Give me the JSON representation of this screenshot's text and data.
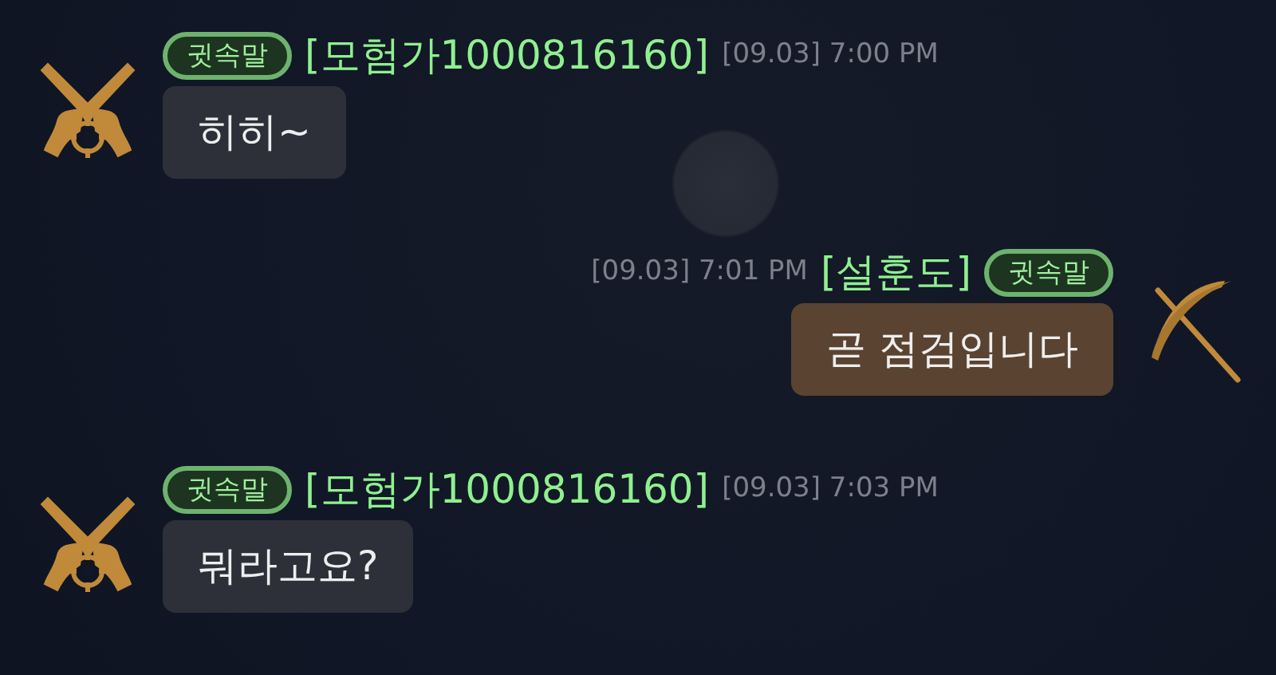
{
  "messages": [
    {
      "mine": false,
      "kind": "pistols",
      "tag": "귓속말",
      "sender": "[모험가1000816160]",
      "time": "[09.03] 7:00 PM",
      "text": "히히~"
    },
    {
      "mine": true,
      "kind": "pickaxe",
      "tag": "귓속말",
      "sender": "[설훈도]",
      "time": "[09.03] 7:01 PM",
      "text": "곧 점검입니다"
    },
    {
      "mine": false,
      "kind": "pistols",
      "tag": "귓속말",
      "sender": "[모험가1000816160]",
      "time": "[09.03] 7:03 PM",
      "text": "뭐라고요?"
    }
  ]
}
